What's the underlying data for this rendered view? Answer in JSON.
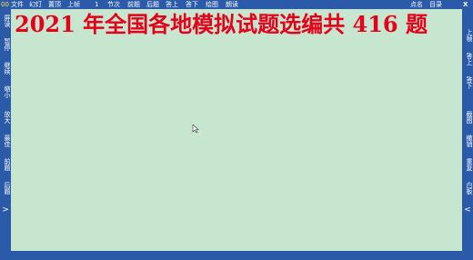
{
  "topbar": {
    "left_glyph": "00",
    "menu": [
      "文件",
      "幻灯",
      "置顶",
      "上帧",
      "1",
      "节次",
      "前题",
      "后题",
      "答上",
      "答下",
      "绘图",
      "朗读"
    ],
    "right_menu": [
      "点名",
      "目录"
    ],
    "close_label": "X"
  },
  "left_sidebar": {
    "buttons": [
      "屏读",
      "暂停",
      "继续",
      "缩小",
      "放大",
      "最佳",
      "前题",
      "后题"
    ],
    "arrow": ">"
  },
  "right_sidebar": {
    "buttons": [
      "上帧",
      "答上",
      "答下",
      "截图",
      "撤销",
      "重复",
      "白板"
    ],
    "arrow": "<"
  },
  "main": {
    "title": "2021 年全国各地模拟试题选编共 416 题"
  },
  "colors": {
    "bar": "#2a5aa8",
    "background": "#c6e6cf",
    "title": "#e6001a"
  }
}
